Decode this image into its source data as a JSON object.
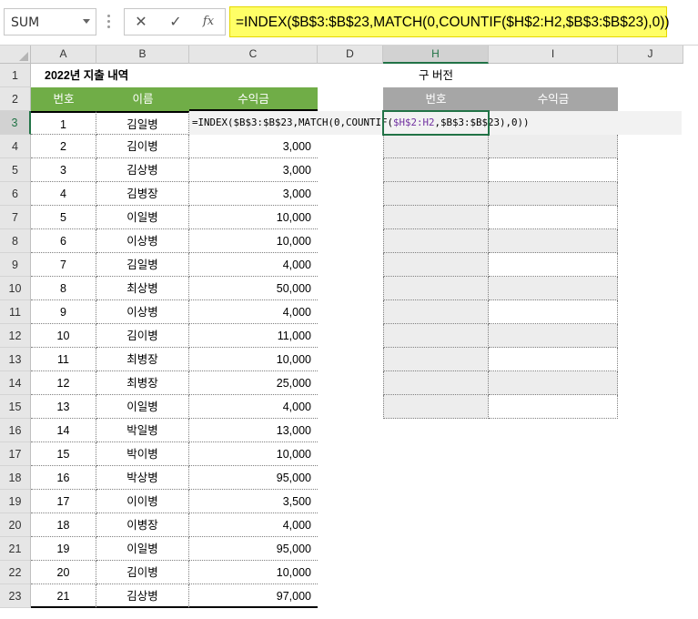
{
  "formula_bar": {
    "name_box": "SUM",
    "formula": "=INDEX($B$3:$B$23,MATCH(0,COUNTIF($H$2:H2,$B$3:$B$23),0))",
    "cancel_icon": "✕",
    "enter_icon": "✓",
    "fx_label": "fx"
  },
  "columns": [
    "A",
    "B",
    "C",
    "D",
    "H",
    "I",
    "J"
  ],
  "rows": [
    "1",
    "2",
    "3",
    "4",
    "5",
    "6",
    "7",
    "8",
    "9",
    "10",
    "11",
    "12",
    "13",
    "14",
    "15",
    "16",
    "17",
    "18",
    "19",
    "20",
    "21",
    "22",
    "23"
  ],
  "sheet": {
    "title": "2022년 지출 내역",
    "old_version_label": "구 버전",
    "headers": {
      "no": "번호",
      "name": "이름",
      "income": "수익금"
    },
    "right_headers": {
      "no": "번호",
      "income": "수익금"
    },
    "formula_in_cell": {
      "p1": "=INDEX($B$3:$B$23,MATCH(0,COUNTIF(",
      "p2": "$H$2:H2",
      "p3": ",$B$3:$B$23),0))"
    },
    "data": [
      {
        "no": "1",
        "name": "김일병",
        "income": ""
      },
      {
        "no": "2",
        "name": "김이병",
        "income": "3,000"
      },
      {
        "no": "3",
        "name": "김상병",
        "income": "3,000"
      },
      {
        "no": "4",
        "name": "김병장",
        "income": "3,000"
      },
      {
        "no": "5",
        "name": "이일병",
        "income": "10,000"
      },
      {
        "no": "6",
        "name": "이상병",
        "income": "10,000"
      },
      {
        "no": "7",
        "name": "김일병",
        "income": "4,000"
      },
      {
        "no": "8",
        "name": "최상병",
        "income": "50,000"
      },
      {
        "no": "9",
        "name": "이상병",
        "income": "4,000"
      },
      {
        "no": "10",
        "name": "김이병",
        "income": "11,000"
      },
      {
        "no": "11",
        "name": "최병장",
        "income": "10,000"
      },
      {
        "no": "12",
        "name": "최병장",
        "income": "25,000"
      },
      {
        "no": "13",
        "name": "이일병",
        "income": "4,000"
      },
      {
        "no": "14",
        "name": "박일병",
        "income": "13,000"
      },
      {
        "no": "15",
        "name": "박이병",
        "income": "10,000"
      },
      {
        "no": "16",
        "name": "박상병",
        "income": "95,000"
      },
      {
        "no": "17",
        "name": "이이병",
        "income": "3,500"
      },
      {
        "no": "18",
        "name": "이병장",
        "income": "4,000"
      },
      {
        "no": "19",
        "name": "이일병",
        "income": "95,000"
      },
      {
        "no": "20",
        "name": "김이병",
        "income": "10,000"
      },
      {
        "no": "21",
        "name": "김상병",
        "income": "97,000"
      }
    ]
  },
  "colors": {
    "header_green": "#70ad47",
    "header_gray": "#a6a6a6",
    "formula_highlight": "#ffff66",
    "active_border": "#217346"
  }
}
